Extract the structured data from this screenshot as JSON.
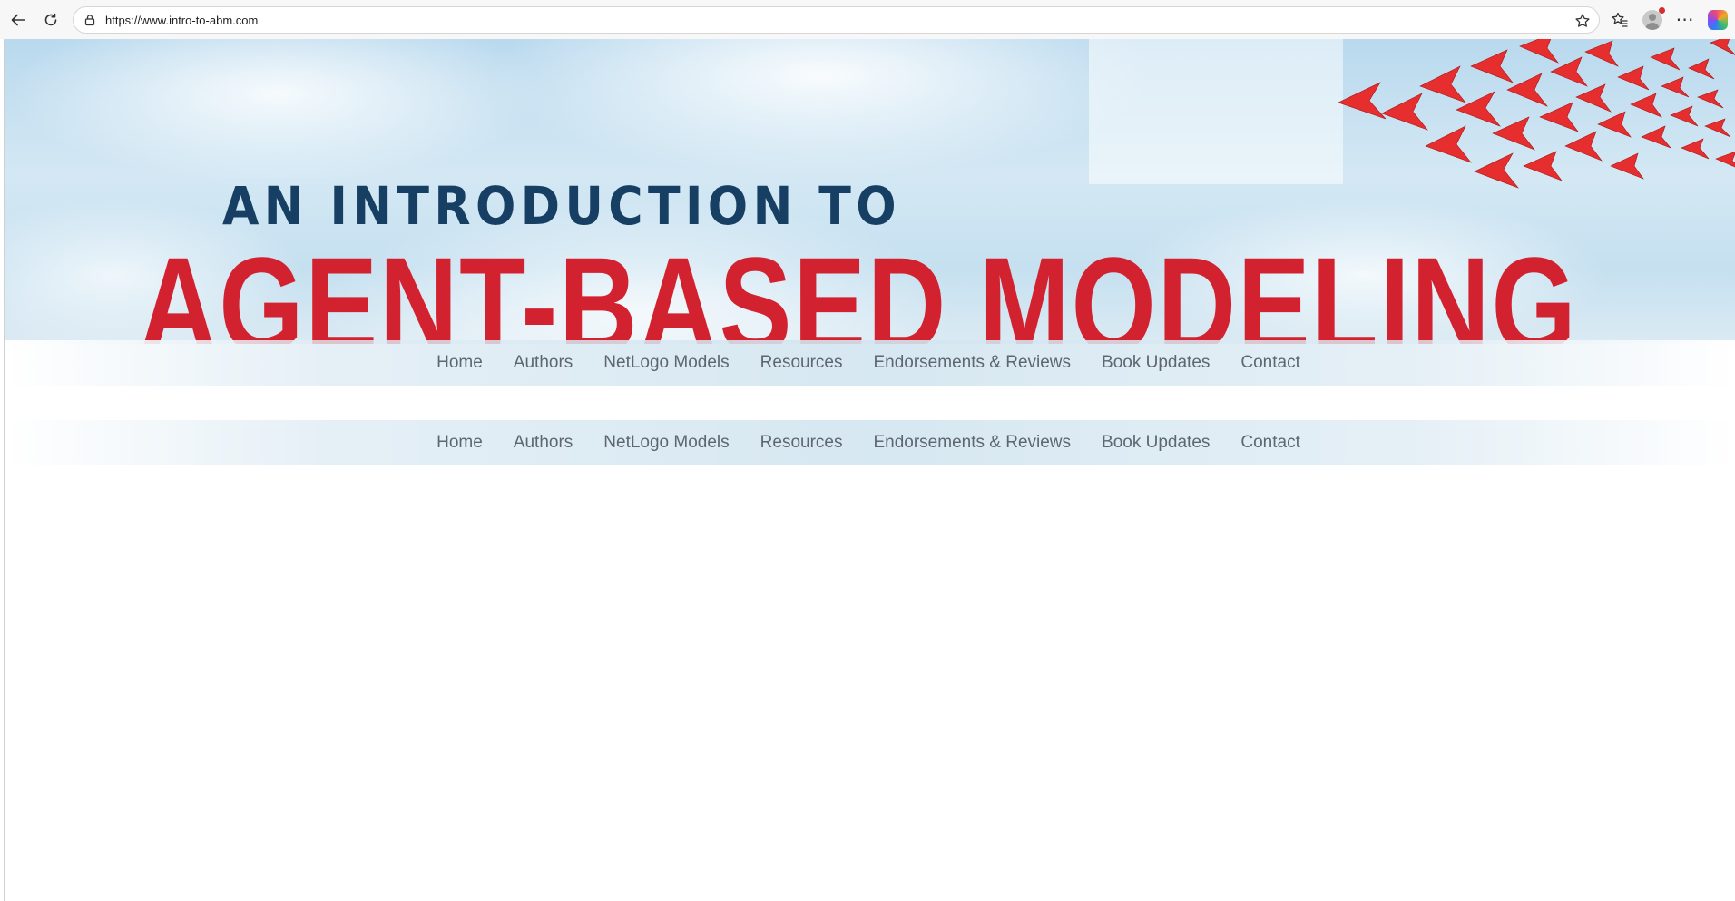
{
  "browser": {
    "url": "https://www.intro-to-abm.com",
    "icons": {
      "back": "arrow-left-icon",
      "reload": "reload-icon",
      "lock": "lock-icon",
      "favorite": "star-icon",
      "favorites": "favorites-icon",
      "profile": "profile-icon",
      "menu": "more-icon",
      "copilot": "copilot-icon"
    }
  },
  "banner": {
    "line1": "AN INTRODUCTION TO",
    "line2": "AGENT-BASED MODELING",
    "colors": {
      "line1": "#163f63",
      "line2": "#d3222f",
      "arrows": "#e62e2e"
    }
  },
  "nav_primary": {
    "items": [
      {
        "label": "Home"
      },
      {
        "label": "Authors"
      },
      {
        "label": "NetLogo Models"
      },
      {
        "label": "Resources"
      },
      {
        "label": "Endorsements & Reviews"
      },
      {
        "label": "Book Updates"
      },
      {
        "label": "Contact"
      }
    ]
  },
  "nav_secondary": {
    "items": [
      {
        "label": "Home"
      },
      {
        "label": "Authors"
      },
      {
        "label": "NetLogo Models"
      },
      {
        "label": "Resources"
      },
      {
        "label": "Endorsements & Reviews"
      },
      {
        "label": "Book Updates"
      },
      {
        "label": "Contact"
      }
    ]
  }
}
